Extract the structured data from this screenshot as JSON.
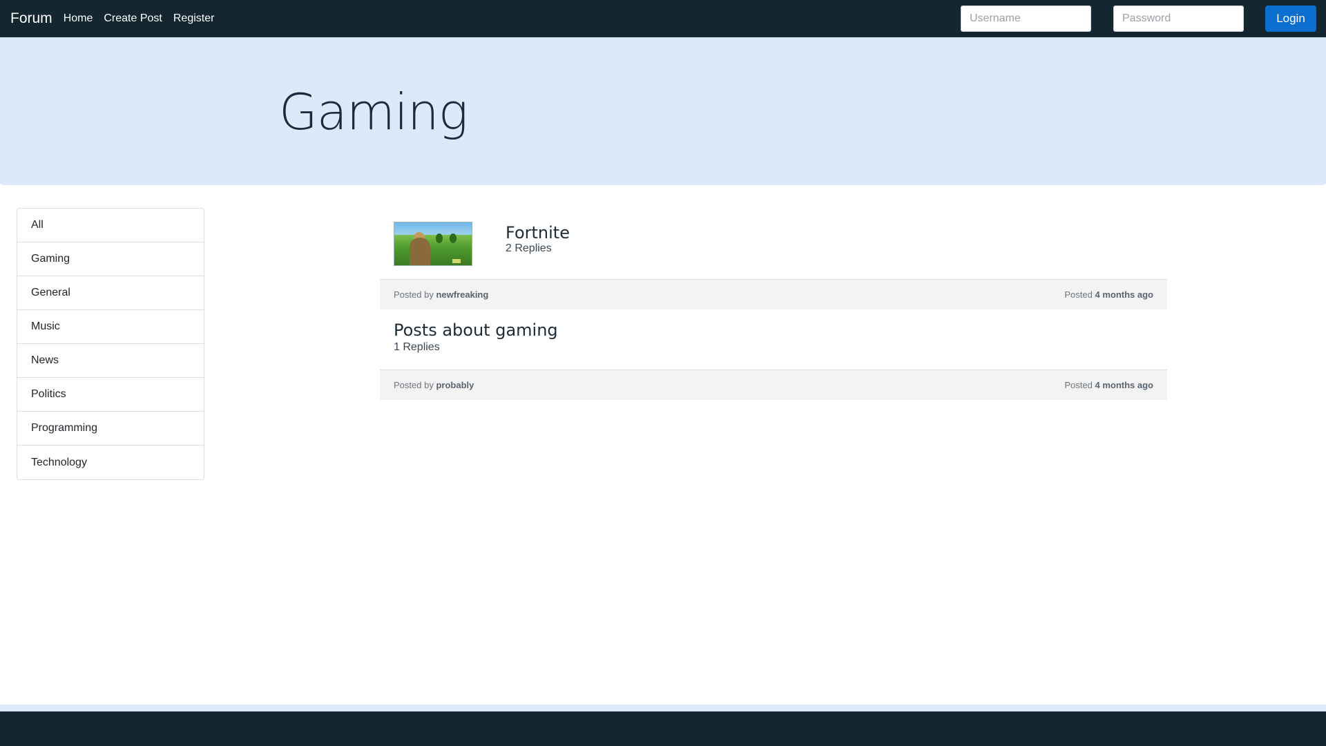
{
  "navbar": {
    "brand": "Forum",
    "links": [
      "Home",
      "Create Post",
      "Register"
    ],
    "username_placeholder": "Username",
    "password_placeholder": "Password",
    "login_label": "Login"
  },
  "hero": {
    "title": "Gaming"
  },
  "sidebar": {
    "items": [
      "All",
      "Gaming",
      "General",
      "Music",
      "News",
      "Politics",
      "Programming",
      "Technology"
    ]
  },
  "posts": [
    {
      "title": "Fortnite",
      "replies": "2 Replies",
      "posted_by_label": "Posted by",
      "author": "newfreaking",
      "posted_label": "Posted",
      "time": "4 months ago",
      "has_thumbnail": true
    },
    {
      "title": "Posts about gaming",
      "replies": "1 Replies",
      "posted_by_label": "Posted by",
      "author": "probably",
      "posted_label": "Posted",
      "time": "4 months ago",
      "has_thumbnail": false
    }
  ],
  "colors": {
    "navbar": "#142731",
    "hero": "#dce9fa",
    "login_button": "#0c6fd0"
  }
}
